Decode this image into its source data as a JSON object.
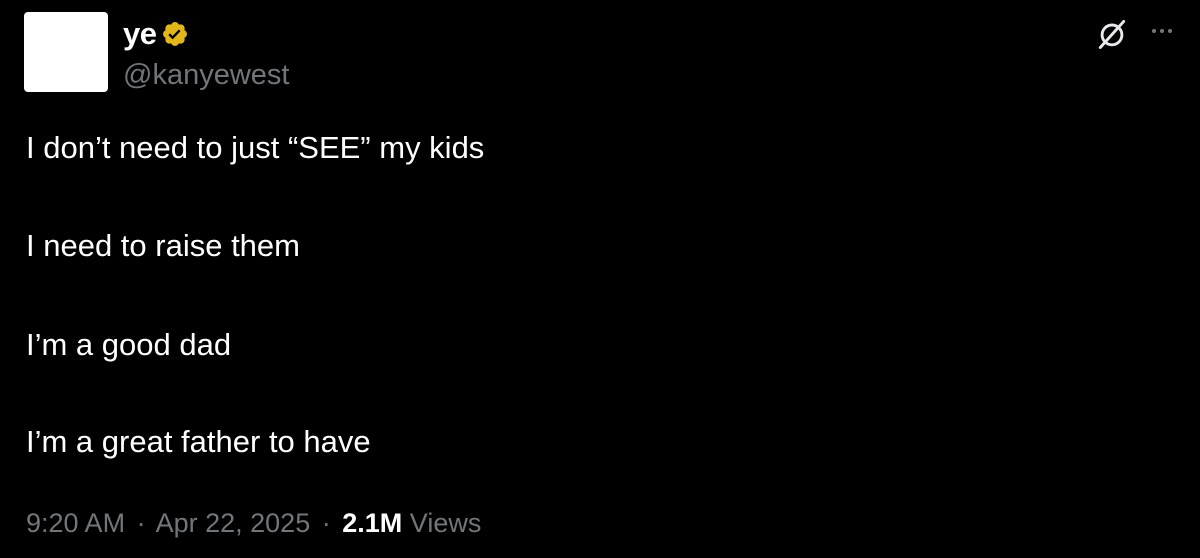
{
  "author": {
    "display_name": "ye",
    "handle": "@kanyewest",
    "verified_badge": "gold-verified-badge-icon",
    "badge_color": "#e2b719"
  },
  "header_actions": {
    "grok_icon": "grok-icon",
    "more_icon": "more-options-icon"
  },
  "tweet": {
    "lines": [
      "I don’t need to just “SEE” my kids",
      "I need to raise them",
      "I’m a good dad",
      "I’m a great father to have"
    ]
  },
  "meta": {
    "time": "9:20 AM",
    "separator": "·",
    "date": "Apr 22, 2025",
    "views_count": "2.1M",
    "views_label": "Views"
  },
  "colors": {
    "background": "#000000",
    "text_primary": "#ffffff",
    "text_secondary": "#71767b"
  }
}
